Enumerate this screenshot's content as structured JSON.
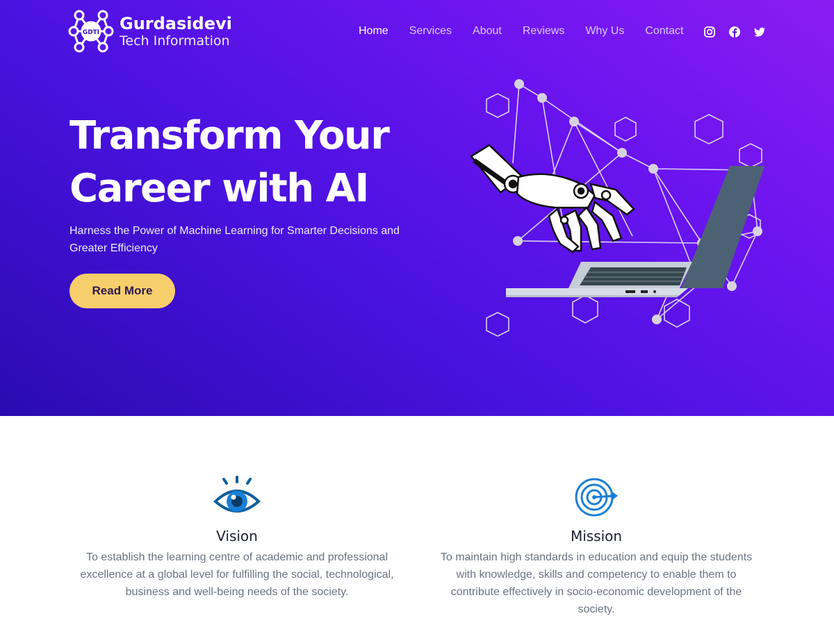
{
  "brand": {
    "name": "Gurdasidevi",
    "tagline": "Tech Information",
    "mark_text": "GDTI"
  },
  "nav": {
    "items": [
      "Home",
      "Services",
      "About",
      "Reviews",
      "Why Us",
      "Contact"
    ],
    "active": "Home"
  },
  "social": [
    "instagram-icon",
    "facebook-icon",
    "twitter-icon"
  ],
  "hero": {
    "title_line1": "Transform Your",
    "title_line2": "Career with AI",
    "subtitle": "Harness the Power of Machine Learning for Smarter Decisions and Greater Efficiency",
    "cta": "Read More"
  },
  "cards": {
    "vision": {
      "title": "Vision",
      "text": "To establish the learning centre of academic and professional excellence at a global level for fulfilling the social, technological, business and well-being needs of the society."
    },
    "mission": {
      "title": "Mission",
      "text": "To maintain high standards in education and equip the students with knowledge, skills and competency to enable them to contribute effectively in socio-economic development of the society."
    }
  },
  "colors": {
    "hero_start": "#2a0bb0",
    "hero_end": "#8b1cf2",
    "cta": "#f6ce6b",
    "icon_blue": "#0f5f9c"
  }
}
